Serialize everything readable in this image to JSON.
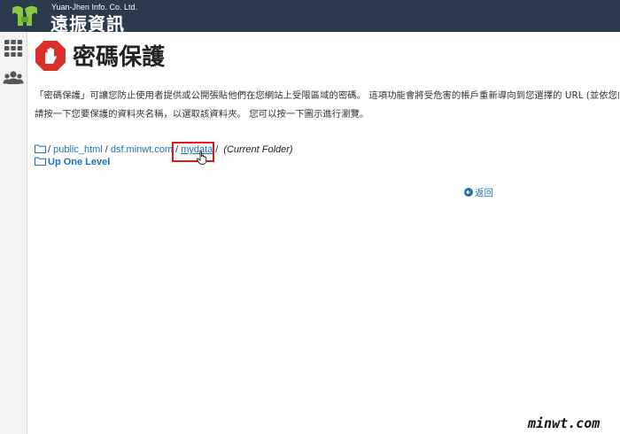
{
  "brand": {
    "sub": "Yuan-Jhen Info. Co. Ltd.",
    "name": "遠振資訊"
  },
  "sidebar": {
    "items": [
      {
        "icon": "apps-grid-icon"
      },
      {
        "icon": "users-icon"
      }
    ]
  },
  "page": {
    "title": "密碼保護",
    "title_icon": "stop-hand-icon"
  },
  "description": {
    "line1": "「密碼保護」可讓您防止使用者提供或公開張貼他們在您網站上受限區域的密碼。 這項功能會將受危害的帳戶重新導向到您選擇的 URL (並依您的選擇",
    "line2": "請按一下您要保護的資料夾名稱，以選取該資料夾。 您可以按一下圖示進行瀏覽。"
  },
  "breadcrumb": {
    "root_sep": "/",
    "items": [
      {
        "label": "public_html"
      },
      {
        "label": "dsf.minwt.com"
      },
      {
        "label": "mydata"
      }
    ],
    "separator": "/",
    "current_label": "(Current Folder)"
  },
  "up_level": {
    "label": "Up One Level"
  },
  "back": {
    "label": "返回"
  },
  "watermark": "minwt.com",
  "colors": {
    "topbar": "#2b3a4c",
    "link": "#1f6fb2",
    "highlight": "#e0191f",
    "stop_icon": "#d9322b"
  }
}
